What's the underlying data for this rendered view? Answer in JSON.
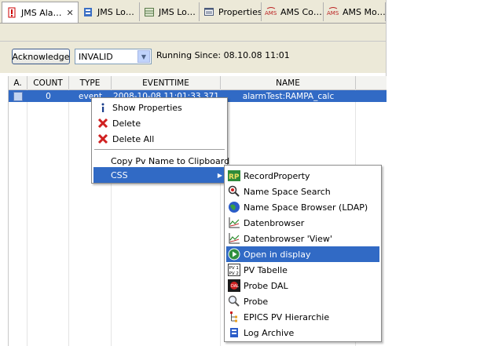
{
  "tabs": [
    {
      "label": "JMS Ala…",
      "icon": "alarm-icon",
      "active": true
    },
    {
      "label": "JMS Lo…",
      "icon": "log-icon"
    },
    {
      "label": "JMS Lo…",
      "icon": "table-icon"
    },
    {
      "label": "Properties",
      "icon": "properties-icon"
    },
    {
      "label": "AMS Co…",
      "icon": "ams-icon"
    },
    {
      "label": "AMS Mo…",
      "icon": "ams-icon"
    }
  ],
  "toolbar": {
    "acknowledge_label": "Acknowledge",
    "filter_value": "INVALID",
    "running_since": "Running Since: 08.10.08 11:01"
  },
  "table": {
    "columns": [
      "A.",
      "COUNT",
      "TYPE",
      "EVENTTIME",
      "NAME"
    ],
    "rows": [
      {
        "count": "0",
        "type": "event",
        "eventtime": "2008-10-08 11:01:33.371",
        "name": "alarmTest:RAMPA_calc"
      }
    ]
  },
  "context_menu": {
    "items": [
      {
        "label": "Show Properties",
        "icon": "info-icon"
      },
      {
        "label": "Delete",
        "icon": "delete-icon"
      },
      {
        "label": "Delete All",
        "icon": "delete-icon"
      },
      {
        "label": "Copy Pv Name to Clipboard"
      },
      {
        "label": "CSS",
        "icon": "submenu-arrow-icon",
        "highlighted": true
      }
    ]
  },
  "css_submenu": {
    "items": [
      {
        "label": "RecordProperty",
        "icon": "rp-icon"
      },
      {
        "label": "Name Space Search",
        "icon": "search-icon"
      },
      {
        "label": "Name Space Browser (LDAP)",
        "icon": "globe-icon"
      },
      {
        "label": "Datenbrowser",
        "icon": "chart-icon"
      },
      {
        "label": "Datenbrowser 'View'",
        "icon": "chart-icon"
      },
      {
        "label": "Open in display",
        "icon": "play-icon",
        "highlighted": true
      },
      {
        "label": "PV Tabelle",
        "icon": "pv-table-icon"
      },
      {
        "label": "Probe DAL",
        "icon": "probe-dal-icon"
      },
      {
        "label": "Probe",
        "icon": "magnifier-icon"
      },
      {
        "label": "EPICS PV Hierarchie",
        "icon": "hierarchy-icon"
      },
      {
        "label": "Log Archive",
        "icon": "archive-icon"
      }
    ]
  },
  "colors": {
    "selection": "#316ac5",
    "chrome": "#ece9d8"
  }
}
